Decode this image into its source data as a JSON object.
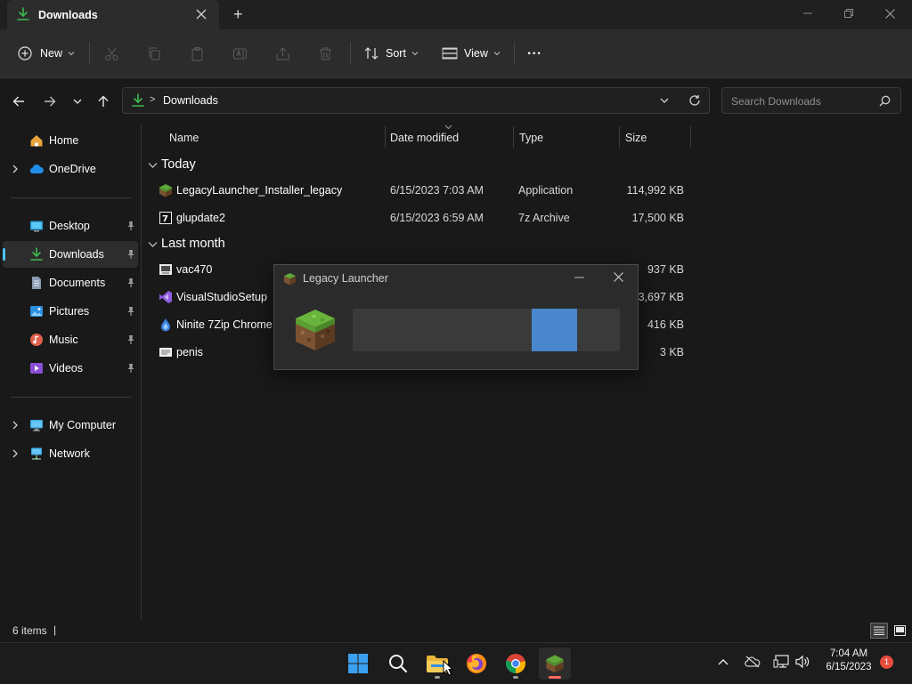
{
  "window": {
    "tab_title": "Downloads",
    "new_tab": "+"
  },
  "toolbar": {
    "new_label": "New",
    "sort_label": "Sort",
    "view_label": "View",
    "more_label": "..."
  },
  "address": {
    "chevron": ">",
    "path": "Downloads",
    "search_placeholder": "Search Downloads"
  },
  "sidebar": {
    "items": [
      {
        "label": "Home"
      },
      {
        "label": "OneDrive"
      },
      {
        "label": "Desktop"
      },
      {
        "label": "Downloads"
      },
      {
        "label": "Documents"
      },
      {
        "label": "Pictures"
      },
      {
        "label": "Music"
      },
      {
        "label": "Videos"
      },
      {
        "label": "My Computer"
      },
      {
        "label": "Network"
      }
    ]
  },
  "columns": {
    "name": "Name",
    "date": "Date modified",
    "type": "Type",
    "size": "Size"
  },
  "groups": {
    "today": "Today",
    "last_month": "Last month"
  },
  "files": [
    {
      "name": "LegacyLauncher_Installer_legacy",
      "date": "6/15/2023 7:03 AM",
      "type": "Application",
      "size": "114,992 KB"
    },
    {
      "name": "glupdate2",
      "date": "6/15/2023 6:59 AM",
      "type": "7z Archive",
      "size": "17,500 KB"
    },
    {
      "name": "vac470",
      "date": "",
      "type": "",
      "size": "937 KB"
    },
    {
      "name": "VisualStudioSetup",
      "date": "",
      "type": "",
      "size": "3,697 KB"
    },
    {
      "name": "Ninite 7Zip Chrome F",
      "date": "",
      "type": "",
      "size": "416 KB"
    },
    {
      "name": "penis",
      "date": "",
      "type": "",
      "size": "3 KB"
    }
  ],
  "status": {
    "items_count": "6 items",
    "separator": "|"
  },
  "dialog": {
    "title": "Legacy Launcher",
    "progress_chunk_start_pct": 67,
    "progress_chunk_width_pct": 17
  },
  "taskbar": {
    "time": "7:04 AM",
    "date": "6/15/2023",
    "notification_count": "1"
  },
  "colors": {
    "accent": "#4cc2ff",
    "progress": "#4a86cc",
    "download_icon": "#3fb950",
    "badge": "#e74c3c"
  }
}
